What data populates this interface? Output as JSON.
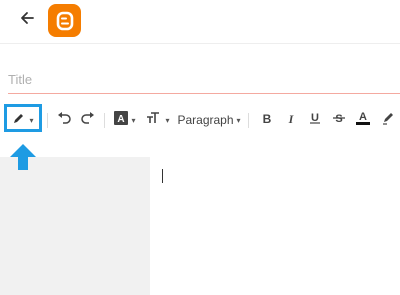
{
  "header": {
    "back_icon": "arrow-left-icon",
    "logo_icon": "blogger-logo-icon",
    "logo_color": "#f57d00"
  },
  "editor": {
    "title_placeholder": "Title",
    "title_value": ""
  },
  "toolbar": {
    "items": [
      "pencil-mode-icon",
      "undo-icon",
      "redo-icon",
      "font-icon",
      "text-size-icon",
      "paragraph-dropdown",
      "bold-icon",
      "italic-icon",
      "underline-icon",
      "strikethrough-icon",
      "text-color-icon",
      "highlight-icon"
    ],
    "paragraph_label": "Paragraph",
    "highlight_color": "#1e9be3"
  }
}
